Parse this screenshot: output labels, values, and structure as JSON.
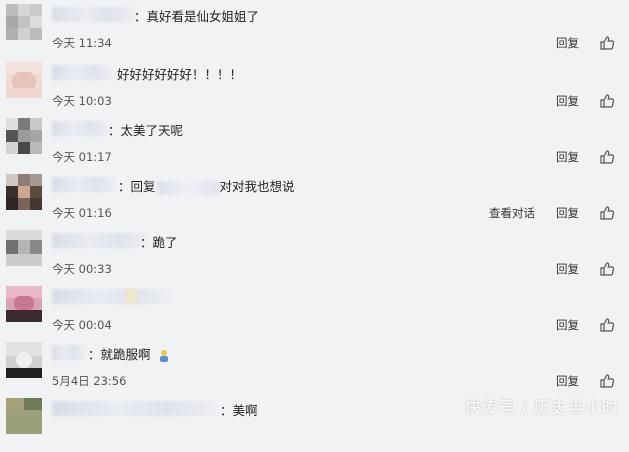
{
  "comments": [
    {
      "text": "：真好看是仙女姐姐了",
      "time": "今天 11:34",
      "reply": "回复"
    },
    {
      "text": "好好好好好好！！！！",
      "time": "今天 10:03",
      "reply": "回复"
    },
    {
      "text": "：太美了天呢",
      "time": "今天 01:17",
      "reply": "回复"
    },
    {
      "text_prefix": "：回复",
      "text_suffix": "对对我也想说",
      "time": "今天 01:16",
      "view_conversation": "查看对话",
      "reply": "回复"
    },
    {
      "text": "：跪了",
      "time": "今天 00:33",
      "reply": "回复"
    },
    {
      "text": "",
      "time": "今天 00:04",
      "reply": "回复"
    },
    {
      "text": "：就跪服啊",
      "time": "5月4日 23:56",
      "reply": "回复"
    },
    {
      "text": "：美啊"
    }
  ],
  "watermark": "快传号 / 历史半小时",
  "icons": {
    "like": "thumbs-up-icon",
    "emoji": "kneeling-emoji-icon"
  },
  "colors": {
    "background": "#f1f2f4",
    "text": "#333333"
  }
}
